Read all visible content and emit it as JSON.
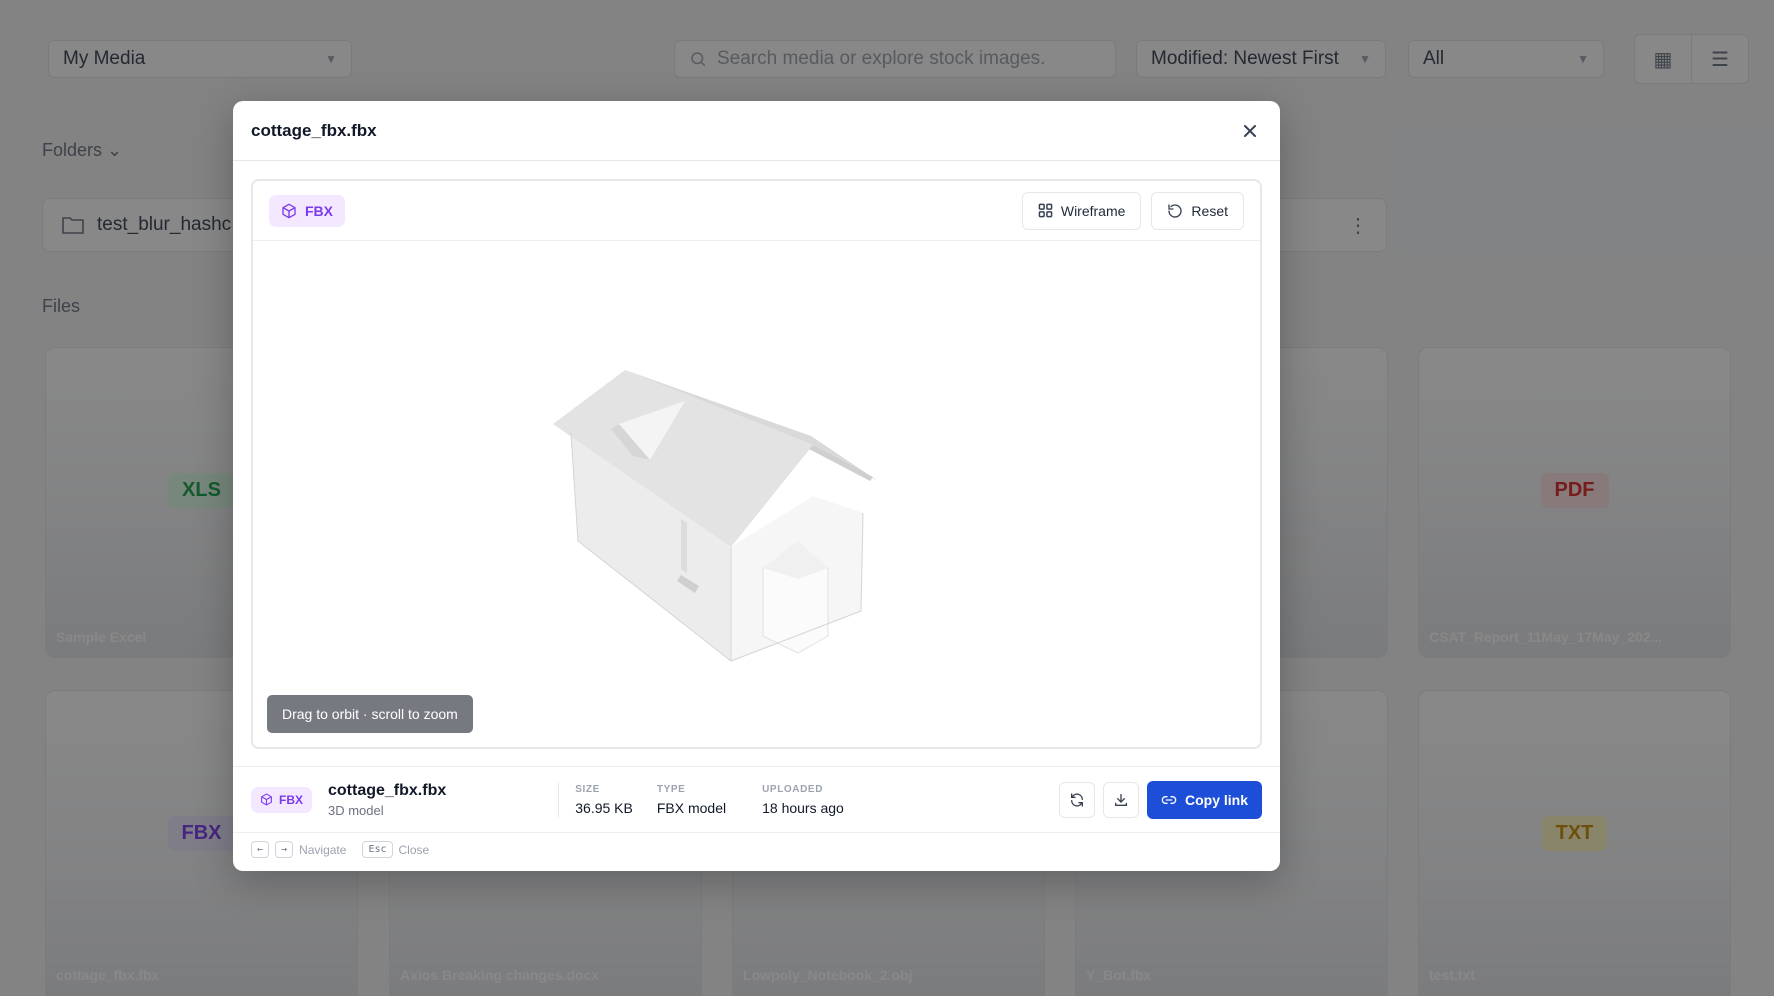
{
  "background": {
    "library_select": "My Media",
    "search_placeholder": "Search media or explore stock images.",
    "sort_select": "Modified: Newest First",
    "filter_select": "All",
    "folders_heading": "Folders",
    "files_heading": "Files",
    "folder_name": "test_blur_hashc",
    "cards": [
      {
        "badge": "XLS",
        "name": "Sample Excel",
        "badge_color": "#16a34a"
      },
      {
        "badge": "PDF",
        "name": "CSAT_Report_11May_17May_202...",
        "badge_color": "#dc2626"
      },
      {
        "badge": "FBX",
        "name": "cottage_fbx.fbx",
        "badge_color": "#7c3aed"
      },
      {
        "badge": "",
        "name": "Axios Breaking changes.docx",
        "badge_color": "#2563eb"
      },
      {
        "badge": "",
        "name": "Lowpoly_Notebook_2.obj",
        "badge_color": "#7c3aed"
      },
      {
        "badge": "",
        "name": "Y_Bot.fbx",
        "badge_color": "#7c3aed"
      },
      {
        "badge": "TXT",
        "name": "test.txt",
        "badge_color": "#ca8a04"
      }
    ]
  },
  "modal": {
    "title": "cottage_fbx.fbx",
    "viewer": {
      "format_chip": "FBX",
      "wireframe_label": "Wireframe",
      "reset_label": "Reset",
      "hint": "Drag to orbit · scroll to zoom"
    },
    "footer": {
      "format_chip": "FBX",
      "file_name": "cottage_fbx.fbx",
      "file_kind": "3D model",
      "size_label": "SIZE",
      "size_value": "36.95 KB",
      "type_label": "TYPE",
      "type_value": "FBX model",
      "uploaded_label": "UPLOADED",
      "uploaded_value": "18 hours ago",
      "copy_link_label": "Copy link"
    },
    "shortcuts": {
      "prev_key": "←",
      "next_key": "→",
      "navigate_label": "Navigate",
      "esc_key": "Esc",
      "close_label": "Close"
    }
  },
  "colors": {
    "accent": "#1d4ed8",
    "fbx_purple": "#7c3aed",
    "overlay": "rgba(17,17,17,0.5)"
  }
}
